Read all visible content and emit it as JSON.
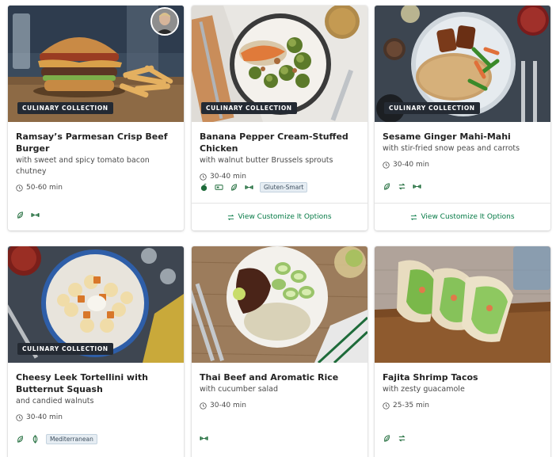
{
  "colors": {
    "brand_green": "#067a46",
    "badge_bg": "#242a33",
    "icon_green": "#1e6b3a"
  },
  "recipes": [
    {
      "badge": "CULINARY COLLECTION",
      "title": "Ramsay’s Parmesan Crisp Beef Burger",
      "subtitle": "with sweet and spicy tomato bacon chutney",
      "time": "50-60 min",
      "tag_icons": [
        "leaf-icon",
        "dumbbell-icon"
      ],
      "pill": "",
      "customize": ""
    },
    {
      "badge": "CULINARY COLLECTION",
      "title": "Banana Pepper Cream-Stuffed Chicken",
      "subtitle": "with walnut butter Brussels sprouts",
      "time": "30-40 min",
      "tag_icons": [
        "apple-icon",
        "calorie-icon",
        "leaf-icon",
        "dumbbell-icon"
      ],
      "pill": "Gluten-Smart",
      "customize": "View Customize It Options"
    },
    {
      "badge": "CULINARY COLLECTION",
      "title": "Sesame Ginger Mahi-Mahi",
      "subtitle": "with stir-fried snow peas and carrots",
      "time": "30-40 min",
      "tag_icons": [
        "leaf-icon",
        "swap-icon",
        "dumbbell-icon"
      ],
      "pill": "",
      "customize": "View Customize It Options"
    },
    {
      "badge": "CULINARY COLLECTION",
      "title": "Cheesy Leek Tortellini with Butternut Squash",
      "subtitle": "and candied walnuts",
      "time": "30-40 min",
      "tag_icons": [
        "leaf-icon",
        "vegetarian-icon"
      ],
      "pill": "Mediterranean",
      "customize": ""
    },
    {
      "badge": "",
      "title": "Thai Beef and Aromatic Rice",
      "subtitle": "with cucumber salad",
      "time": "30-40 min",
      "tag_icons": [
        "dumbbell-icon"
      ],
      "pill": "",
      "customize": ""
    },
    {
      "badge": "",
      "title": "Fajita Shrimp Tacos",
      "subtitle": "with zesty guacamole",
      "time": "25-35 min",
      "tag_icons": [
        "leaf-icon",
        "swap-icon"
      ],
      "pill": "",
      "customize": ""
    }
  ]
}
